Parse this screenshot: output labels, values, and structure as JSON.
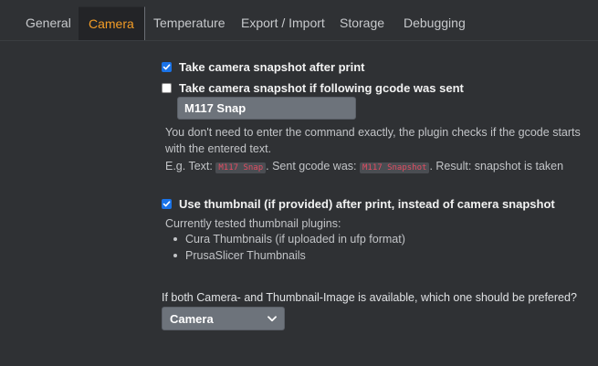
{
  "tabs": [
    {
      "label": "General",
      "active": false
    },
    {
      "label": "Camera",
      "active": true
    },
    {
      "label": "Temperature",
      "active": false
    },
    {
      "label": "Export / Import",
      "active": false
    },
    {
      "label": "Storage",
      "active": false
    },
    {
      "label": "Debugging",
      "active": false
    }
  ],
  "camera": {
    "snapshot_after_print": {
      "label": "Take camera snapshot after print",
      "checked": true
    },
    "snapshot_on_gcode": {
      "label": "Take camera snapshot if following gcode was sent",
      "checked": false
    },
    "gcode_value": "M117 Snap",
    "help_line1": "You don't need to enter the command exactly, the plugin checks if the gcode starts",
    "help_line2": "with the entered text.",
    "example": {
      "prefix": "E.g. Text: ",
      "text_code": "M117 Snap",
      "middle": ". Sent gcode was: ",
      "sent_code": "M117 Snapshot",
      "suffix": ". Result: snapshot is taken"
    },
    "use_thumbnail": {
      "label": "Use thumbnail (if provided) after print, instead of camera snapshot",
      "checked": true
    },
    "tested_plugins_heading": "Currently tested thumbnail plugins:",
    "tested_plugins": [
      "Cura Thumbnails (if uploaded in ufp format)",
      "PrusaSlicer Thumbnails"
    ],
    "prefer_question": "If both Camera- and Thumbnail-Image is available, which one should be prefered?",
    "prefer_selected": "Camera"
  },
  "colors": {
    "background": "#2f3134",
    "active_tab_text": "#f39c26",
    "checkbox_checked": "#1a73e8",
    "inline_code_text": "#e14d62"
  }
}
